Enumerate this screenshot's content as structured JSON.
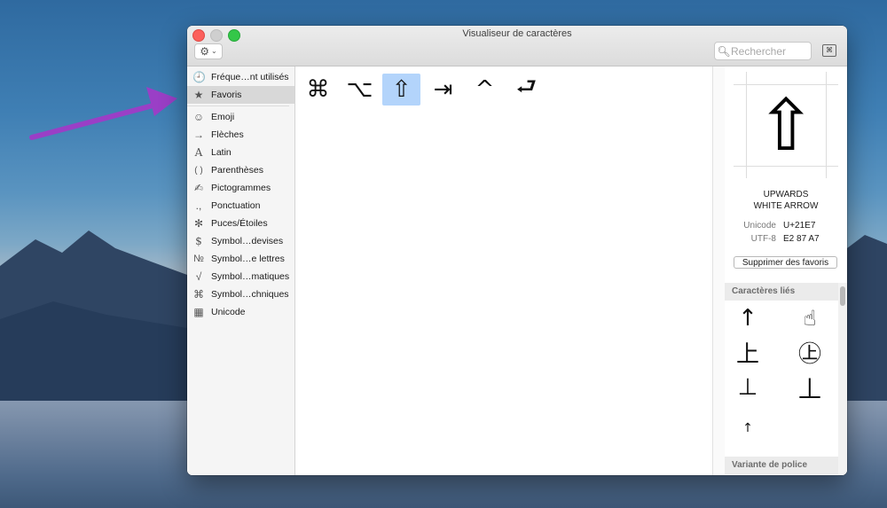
{
  "window": {
    "title": "Visualiseur de caractères"
  },
  "toolbar": {
    "gear_icon": "gear-icon",
    "search_placeholder": "Rechercher",
    "search_value": ""
  },
  "sidebar": {
    "items": [
      {
        "icon": "🕘",
        "label": "Fréque…nt utilisés"
      },
      {
        "icon": "★",
        "label": "Favoris",
        "selected": true
      },
      {
        "icon": "☺",
        "label": "Emoji"
      },
      {
        "icon": "→",
        "label": "Flèches"
      },
      {
        "icon": "A",
        "label": "Latin"
      },
      {
        "icon": "( )",
        "label": "Parenthèses"
      },
      {
        "icon": "✍",
        "label": "Pictogrammes"
      },
      {
        "icon": ".,",
        "label": "Ponctuation"
      },
      {
        "icon": "✻",
        "label": "Puces/Étoiles"
      },
      {
        "icon": "$",
        "label": "Symbol…devises"
      },
      {
        "icon": "№",
        "label": "Symbol…e lettres"
      },
      {
        "icon": "√",
        "label": "Symbol…matiques"
      },
      {
        "icon": "⌘",
        "label": "Symbol…chniques"
      },
      {
        "icon": "▦",
        "label": "Unicode"
      }
    ]
  },
  "favorites": [
    "⌘",
    "⌥",
    "⇧",
    "⇥",
    "^",
    "⮐"
  ],
  "selected_index": 2,
  "inspector": {
    "glyph": "⇧",
    "name_line1": "UPWARDS",
    "name_line2": "WHITE ARROW",
    "unicode_label": "Unicode",
    "unicode_value": "U+21E7",
    "utf8_label": "UTF-8",
    "utf8_value": "E2 87 A7",
    "remove_button": "Supprimer des favoris",
    "related_header": "Caractères liés",
    "related": [
      "↑",
      "☝",
      "上",
      "㊤",
      "⊥",
      "丄",
      "↑"
    ],
    "variant_header": "Variante de police"
  }
}
